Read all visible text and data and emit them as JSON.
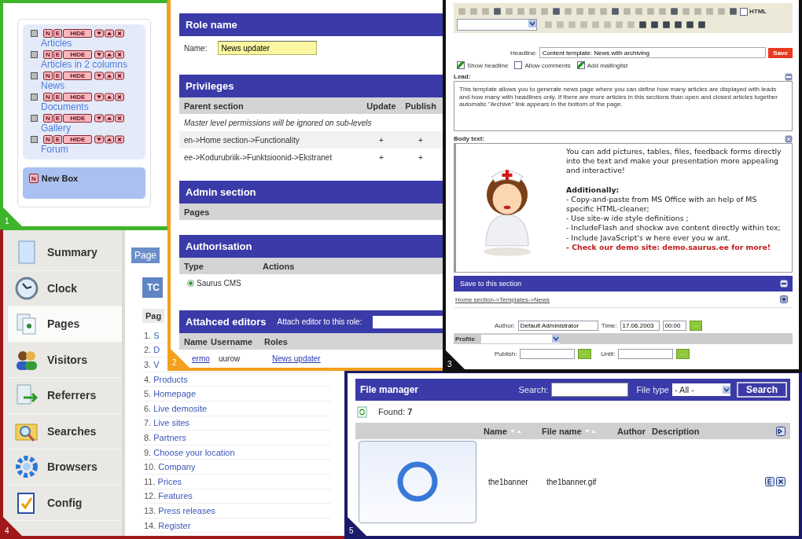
{
  "panel_1": {
    "number": "1",
    "boxes": [
      {
        "label": "Articles",
        "buttons": [
          "N",
          "E",
          "HIDE"
        ]
      },
      {
        "label": "Articles in 2 columns",
        "buttons": [
          "N",
          "E",
          "HIDE"
        ]
      },
      {
        "label": "News",
        "buttons": [
          "N",
          "E",
          "HIDE"
        ]
      },
      {
        "label": "Documents",
        "buttons": [
          "N",
          "E",
          "HIDE"
        ]
      },
      {
        "label": "Gallery",
        "buttons": [
          "N",
          "E",
          "HIDE"
        ]
      },
      {
        "label": "Forum",
        "buttons": [
          "N",
          "E",
          "HIDE"
        ]
      }
    ],
    "new_box": {
      "button": "N",
      "label": "New Box"
    }
  },
  "panel_2": {
    "number": "2",
    "role_name": {
      "title": "Role name",
      "name_label": "Name:",
      "name_value": "News updater"
    },
    "privileges": {
      "title": "Privileges",
      "columns": [
        "Parent section",
        "Update",
        "Publish"
      ],
      "note": "Master level permissions will be ignored on sub-levels",
      "rows": [
        {
          "section": "en->Home section->Functionality",
          "update": "+",
          "publish": "+"
        },
        {
          "section": "ee->Kodurubriik->Funktsioonid->Ekstranet",
          "update": "+",
          "publish": "+"
        }
      ]
    },
    "admin_section": {
      "title": "Admin section",
      "columns": [
        "Pages"
      ]
    },
    "authorisation": {
      "title": "Authorisation",
      "columns": [
        "Type",
        "Actions"
      ],
      "options": [
        {
          "label": "Saurus CMS",
          "selected": true
        }
      ]
    },
    "editors": {
      "title": "Attahced editors",
      "attach_label": "Attach editor to this role:",
      "columns": [
        "Name",
        "Username",
        "Roles"
      ],
      "rows": [
        {
          "name": "ermo",
          "username": "uurow",
          "roles": "News updater"
        }
      ]
    }
  },
  "panel_3": {
    "number": "3",
    "html_toggle": {
      "label": "HTML",
      "checked": false
    },
    "headline": {
      "label": "Headline:",
      "value": "Content template: News with archiving",
      "save": "Save"
    },
    "options": [
      {
        "label": "Show headline",
        "checked": true
      },
      {
        "label": "Allow comments",
        "checked": false
      },
      {
        "label": "Add mailinglist",
        "checked": true
      }
    ],
    "lead": {
      "label": "Lead:",
      "text": "This template allows you to generate news page where you can define how many articles are displayed with leads and how many with headlines only. If there are more articles in this sections than open and closed articles together automatic \"Archive\" link appears in the bottom of the page."
    },
    "body": {
      "label": "Body text:",
      "intro": "You can add pictures, tables, files, feedback forms directly into the text and make your presentation more appealing and interactive!",
      "heading": "Additionally:",
      "items": [
        {
          "text": "- Copy-and-paste from MS Office with an help of MS specific HTML-cleaner;",
          "kind": "normal"
        },
        {
          "text": "- Use site-w ide style definitions ;",
          "kind": "normal"
        },
        {
          "text": "- IncludeFlash and shockw ave content directly within tex;",
          "kind": "normal"
        },
        {
          "text": "- Include JavaScript's w here ever you w ant.",
          "kind": "normal"
        },
        {
          "text": "- Check our demo site: demo.saurus.ee for more!",
          "kind": "highlight"
        }
      ]
    },
    "save_section": {
      "title": "Save to this section",
      "path": "Home section->Templates->News"
    },
    "author": {
      "label": "Author:",
      "value": "Default Administrator"
    },
    "time": {
      "label": "Time:",
      "date": "17.06.2003",
      "hour": "00:00",
      "button": "..."
    },
    "profile": {
      "label": "Profile"
    },
    "publish": {
      "label": "Publish:",
      "button": "..."
    },
    "until": {
      "label": "Until:",
      "button": "..."
    }
  },
  "panel_4": {
    "number": "4",
    "nav": [
      {
        "label": "Summary",
        "selected": false
      },
      {
        "label": "Clock",
        "selected": false
      },
      {
        "label": "Pages",
        "selected": true
      },
      {
        "label": "Visitors",
        "selected": false
      },
      {
        "label": "Referrers",
        "selected": false
      },
      {
        "label": "Searches",
        "selected": false
      },
      {
        "label": "Browsers",
        "selected": false
      },
      {
        "label": "Config",
        "selected": false
      }
    ],
    "tab": "Page",
    "box": "TC",
    "list_header": "Pag",
    "pages": [
      {
        "num": "1.",
        "title": "S"
      },
      {
        "num": "2.",
        "title": "D"
      },
      {
        "num": "3.",
        "title": "V"
      },
      {
        "num": "4.",
        "title": "Products"
      },
      {
        "num": "5.",
        "title": "Homepage"
      },
      {
        "num": "6.",
        "title": "Live demosite"
      },
      {
        "num": "7.",
        "title": "Live sites"
      },
      {
        "num": "8.",
        "title": "Partners"
      },
      {
        "num": "9.",
        "title": "Choose your location"
      },
      {
        "num": "10.",
        "title": "Company"
      },
      {
        "num": "11.",
        "title": "Prices"
      },
      {
        "num": "12.",
        "title": "Features"
      },
      {
        "num": "13.",
        "title": "Press releases"
      },
      {
        "num": "14.",
        "title": "Register"
      }
    ]
  },
  "panel_5": {
    "number": "5",
    "title": "File manager",
    "search_label": "Search:",
    "file_type_label": "File type",
    "file_type_value": "- All -",
    "search_button": "Search",
    "found": "Found: **7**",
    "columns": [
      "Name",
      "File name",
      "Author",
      "Description"
    ],
    "rows": [
      {
        "name": "the1banner",
        "file_name": "the1banner.gif"
      }
    ]
  }
}
